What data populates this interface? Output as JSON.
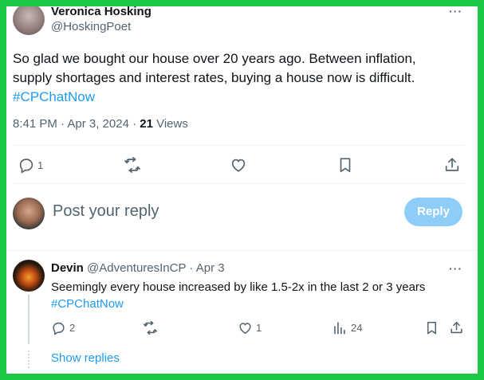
{
  "tweet": {
    "author_name": "Veronica Hosking",
    "author_handle": "@HoskingPoet",
    "more_label": "···",
    "text_line1": "So glad we bought our house over 20 years ago. Between inflation,",
    "text_line2": "supply shortages and interest rates, buying a house now is difficult.",
    "hashtag": "#CPChatNow",
    "timestamp": "8:41 PM · Apr 3, 2024 · ",
    "views_count": "21",
    "views_label": " Views",
    "actions": {
      "replies": "1",
      "reposts": "",
      "likes": "",
      "icons": [
        "reply-icon",
        "repost-icon",
        "like-icon",
        "bookmark-icon",
        "share-icon"
      ]
    }
  },
  "composer": {
    "placeholder": "Post your reply",
    "button_label": "Reply"
  },
  "reply": {
    "author_name": "Devin",
    "author_handle": "@AdventuresInCP",
    "dot": "·",
    "date": "Apr 3",
    "more_label": "···",
    "text": "Seemingly every house increased by like 1.5-2x in the last 2 or 3 years",
    "hashtag": "#CPChatNow",
    "actions": {
      "replies": "2",
      "reposts": "",
      "likes": "1",
      "views": "24"
    },
    "show_replies": "Show replies"
  },
  "colors": {
    "frame_border": "#19c843",
    "accent": "#1d9bf0",
    "reply_button_disabled": "#8ecdf8",
    "muted_text": "#536471"
  }
}
